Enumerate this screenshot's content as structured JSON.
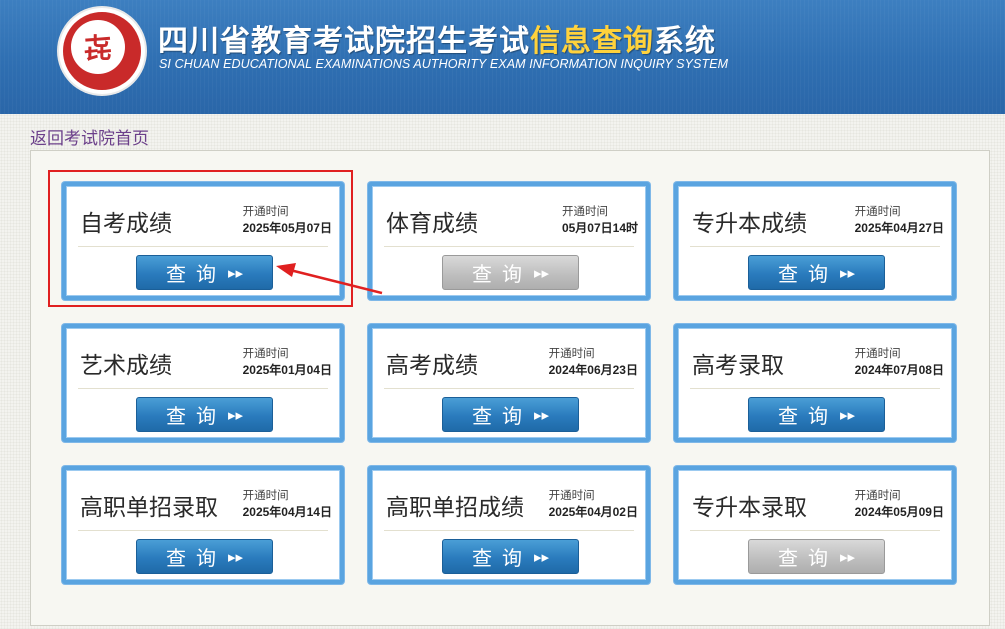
{
  "header": {
    "title_part1": "四川省教育考试院招生考试",
    "title_highlight": "信息查询",
    "title_part2": "系统",
    "subtitle_en": "SI CHUAN EDUCATIONAL EXAMINATIONS AUTHORITY EXAM INFORMATION INQUIRY SYSTEM",
    "logo_glyph": "㐂"
  },
  "nav": {
    "back_link": "返回考试院首页"
  },
  "open_label": "开通时间",
  "query_label": "查询",
  "arrow_glyph": "▸▸",
  "cards": [
    {
      "title": "自考成绩",
      "date": "2025年05月07日",
      "enabled": true
    },
    {
      "title": "体育成绩",
      "date": "05月07日14时",
      "enabled": false
    },
    {
      "title": "专升本成绩",
      "date": "2025年04月27日",
      "enabled": true
    },
    {
      "title": "艺术成绩",
      "date": "2025年01月04日",
      "enabled": true
    },
    {
      "title": "高考成绩",
      "date": "2024年06月23日",
      "enabled": true
    },
    {
      "title": "高考录取",
      "date": "2024年07月08日",
      "enabled": true
    },
    {
      "title": "高职单招录取",
      "date": "2025年04月14日",
      "enabled": true
    },
    {
      "title": "高职单招成绩",
      "date": "2025年04月02日",
      "enabled": true
    },
    {
      "title": "专升本录取",
      "date": "2024年05月09日",
      "enabled": false
    }
  ],
  "colors": {
    "header_blue": "#2f6fb2",
    "title_highlight": "#ffd23c",
    "button_blue": "#2a7bbd",
    "button_disabled": "#bdbdbd",
    "annotation_red": "#e02020"
  }
}
